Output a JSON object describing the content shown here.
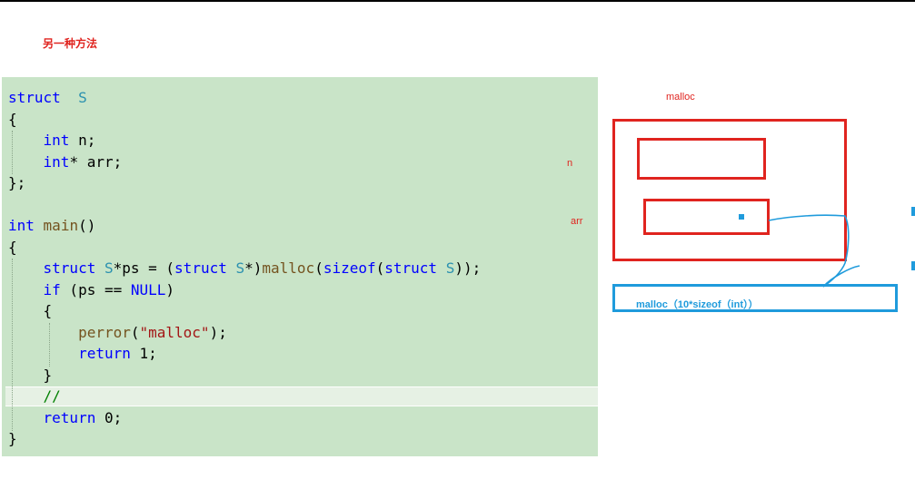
{
  "heading": "另一种方法",
  "code_lines": [
    {
      "parts": [
        [
          "kw",
          "struct"
        ],
        [
          "",
          "  "
        ],
        [
          "ty",
          "S"
        ]
      ]
    },
    {
      "parts": [
        [
          "",
          "{"
        ]
      ]
    },
    {
      "parts": [
        [
          "",
          "    "
        ],
        [
          "kw",
          "int"
        ],
        [
          "",
          " n;"
        ]
      ]
    },
    {
      "parts": [
        [
          "",
          "    "
        ],
        [
          "kw",
          "int"
        ],
        [
          "",
          "* arr;"
        ]
      ]
    },
    {
      "parts": [
        [
          "",
          "};"
        ]
      ]
    },
    {
      "parts": [
        [
          "",
          ""
        ]
      ]
    },
    {
      "parts": [
        [
          "kw",
          "int"
        ],
        [
          "",
          " "
        ],
        [
          "fn",
          "main"
        ],
        [
          "",
          "()"
        ]
      ]
    },
    {
      "parts": [
        [
          "",
          "{"
        ]
      ]
    },
    {
      "parts": [
        [
          "",
          "    "
        ],
        [
          "kw",
          "struct"
        ],
        [
          "",
          " "
        ],
        [
          "ty",
          "S"
        ],
        [
          "",
          "*ps = ("
        ],
        [
          "kw",
          "struct"
        ],
        [
          "",
          " "
        ],
        [
          "ty",
          "S"
        ],
        [
          "",
          "*)"
        ],
        [
          "fn",
          "malloc"
        ],
        [
          "",
          "("
        ],
        [
          "kw",
          "sizeof"
        ],
        [
          "",
          "("
        ],
        [
          "kw",
          "struct"
        ],
        [
          "",
          " "
        ],
        [
          "ty",
          "S"
        ],
        [
          "",
          "));"
        ]
      ]
    },
    {
      "parts": [
        [
          "",
          "    "
        ],
        [
          "kw",
          "if"
        ],
        [
          "",
          " (ps == "
        ],
        [
          "kw",
          "NULL"
        ],
        [
          "",
          ")"
        ]
      ]
    },
    {
      "parts": [
        [
          "",
          "    {"
        ]
      ]
    },
    {
      "parts": [
        [
          "",
          "        "
        ],
        [
          "fn",
          "perror"
        ],
        [
          "",
          "("
        ],
        [
          "st",
          "\"malloc\""
        ],
        [
          "",
          ");"
        ]
      ]
    },
    {
      "parts": [
        [
          "",
          "        "
        ],
        [
          "kw",
          "return"
        ],
        [
          "",
          " 1;"
        ]
      ]
    },
    {
      "parts": [
        [
          "",
          "    }"
        ]
      ]
    },
    {
      "parts": [
        [
          "",
          "    "
        ],
        [
          "cm",
          "//"
        ]
      ]
    },
    {
      "parts": [
        [
          "",
          "    "
        ],
        [
          "kw",
          "return"
        ],
        [
          "",
          " 0;"
        ]
      ]
    },
    {
      "parts": [
        [
          "",
          "}"
        ]
      ]
    }
  ],
  "notes": {
    "malloc_top": "malloc",
    "n": "n",
    "arr": "arr"
  },
  "blue_box_label": "malloc（10*sizeof（int））",
  "colors": {
    "red": "#e0241f",
    "blue": "#1f9bdc",
    "panel": "#c9e4c8"
  }
}
